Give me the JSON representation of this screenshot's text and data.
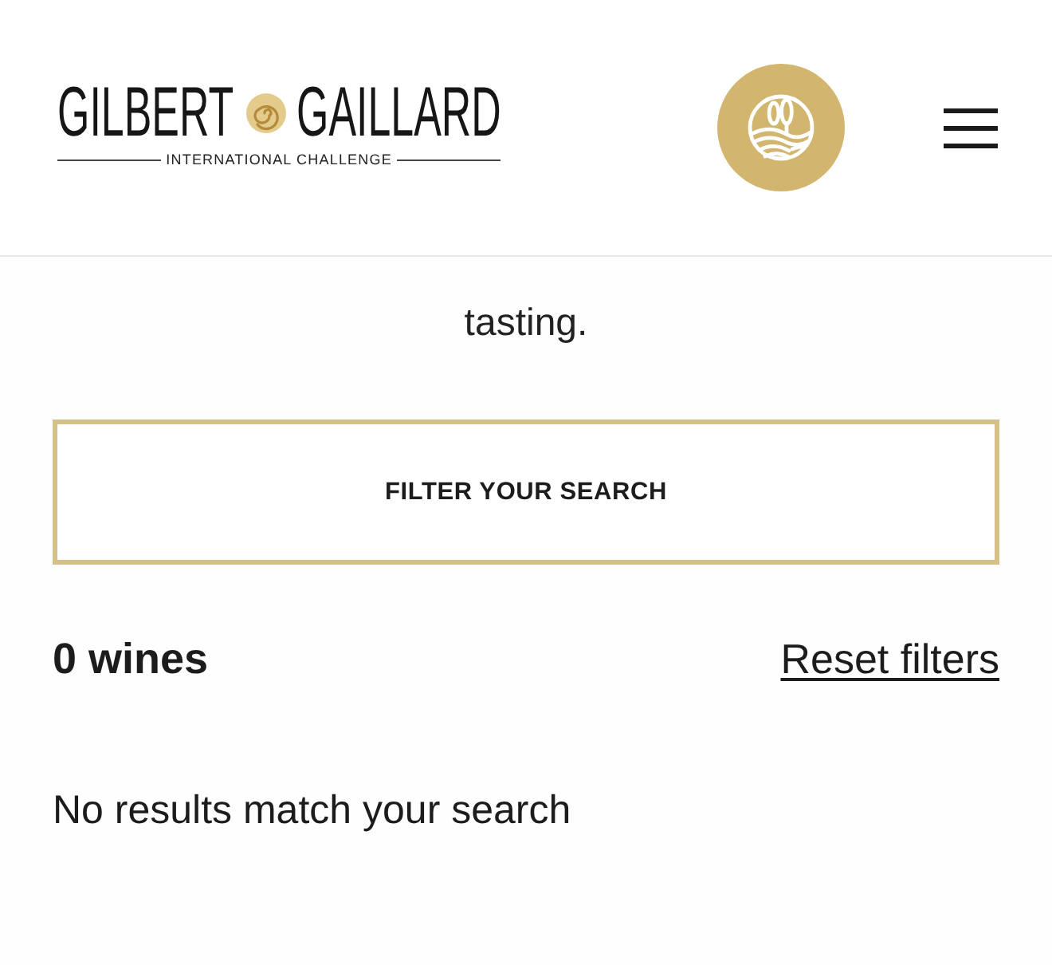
{
  "header": {
    "logo": {
      "name_left": "GILBERT",
      "name_right": "GAILLARD",
      "tagline": "INTERNATIONAL CHALLENGE"
    }
  },
  "intro_text": "tasting.",
  "filter_button": {
    "label": "FILTER YOUR SEARCH"
  },
  "results": {
    "count": "0 wines",
    "reset_link": "Reset filters",
    "message": "No results match your search"
  }
}
